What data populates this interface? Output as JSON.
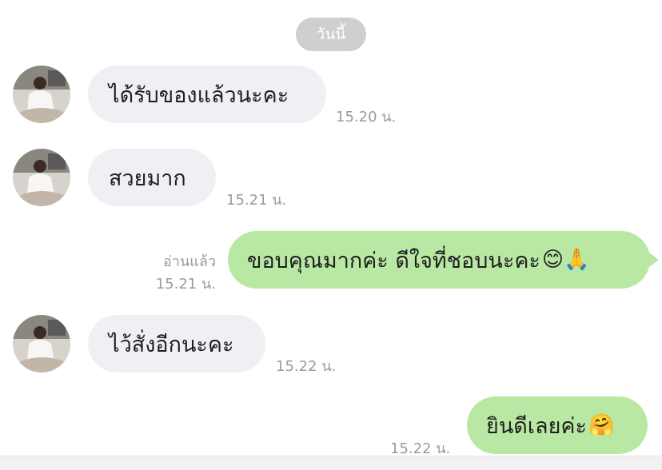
{
  "date_label": "วันนี้",
  "messages": [
    {
      "direction": "in",
      "text": "ได้รับของแล้วนะคะ",
      "time": "15.20 น."
    },
    {
      "direction": "in",
      "text": "สวยมาก",
      "time": "15.21 น."
    },
    {
      "direction": "out",
      "text": "ขอบคุณมากค่ะ ดีใจที่ชอบนะคะ",
      "emoji": "😊🙏",
      "read": "อ่านแล้ว",
      "time": "15.21 น."
    },
    {
      "direction": "in",
      "text": "ไว้สั่งอีกนะคะ",
      "time": "15.22 น."
    },
    {
      "direction": "out",
      "text": "ยินดีเลยค่ะ",
      "emoji": "🤗",
      "time": "15.22 น."
    }
  ],
  "colors": {
    "incoming_bubble": "#eef0f3",
    "outgoing_bubble": "#b9e8a4",
    "date_pill": "#cfcfcf",
    "timestamp": "#9b9b9b"
  },
  "icons": [
    "avatar-photo",
    "smile-emoji",
    "pray-emoji",
    "hug-emoji"
  ]
}
